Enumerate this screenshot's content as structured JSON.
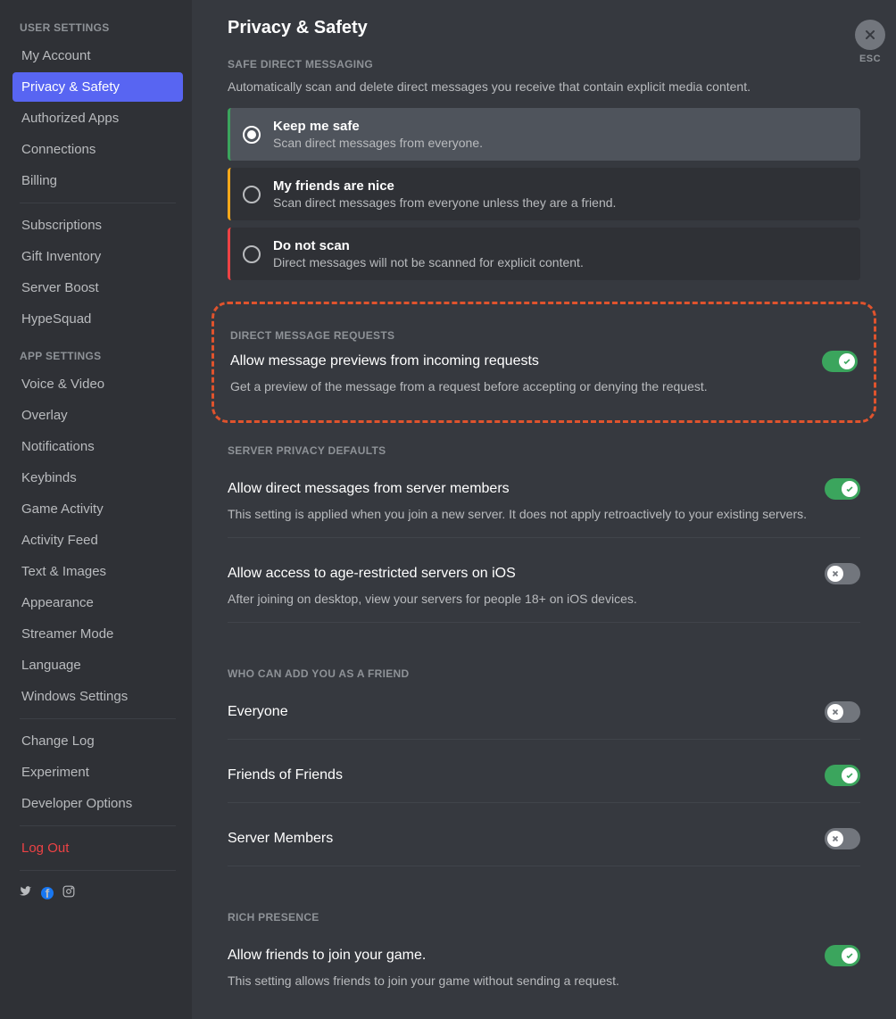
{
  "sidebar": {
    "heading_user": "USER SETTINGS",
    "heading_app": "APP SETTINGS",
    "items_user": [
      {
        "label": "My Account"
      },
      {
        "label": "Privacy & Safety"
      },
      {
        "label": "Authorized Apps"
      },
      {
        "label": "Connections"
      },
      {
        "label": "Billing"
      }
    ],
    "items_user2": [
      {
        "label": "Subscriptions"
      },
      {
        "label": "Gift Inventory"
      },
      {
        "label": "Server Boost"
      },
      {
        "label": "HypeSquad"
      }
    ],
    "items_app": [
      {
        "label": "Voice & Video"
      },
      {
        "label": "Overlay"
      },
      {
        "label": "Notifications"
      },
      {
        "label": "Keybinds"
      },
      {
        "label": "Game Activity"
      },
      {
        "label": "Activity Feed"
      },
      {
        "label": "Text & Images"
      },
      {
        "label": "Appearance"
      },
      {
        "label": "Streamer Mode"
      },
      {
        "label": "Language"
      },
      {
        "label": "Windows Settings"
      }
    ],
    "items_misc": [
      {
        "label": "Change Log"
      },
      {
        "label": "Experiment"
      },
      {
        "label": "Developer Options"
      }
    ],
    "logout": "Log Out"
  },
  "esc_label": "ESC",
  "page_title": "Privacy & Safety",
  "safe_dm": {
    "heading": "SAFE DIRECT MESSAGING",
    "desc": "Automatically scan and delete direct messages you receive that contain explicit media content.",
    "options": [
      {
        "title": "Keep me safe",
        "sub": "Scan direct messages from everyone."
      },
      {
        "title": "My friends are nice",
        "sub": "Scan direct messages from everyone unless they are a friend."
      },
      {
        "title": "Do not scan",
        "sub": "Direct messages will not be scanned for explicit content."
      }
    ]
  },
  "dm_requests": {
    "heading": "DIRECT MESSAGE REQUESTS",
    "title": "Allow message previews from incoming requests",
    "sub": "Get a preview of the message from a request before accepting or denying the request."
  },
  "server_privacy": {
    "heading": "SERVER PRIVACY DEFAULTS",
    "row1_title": "Allow direct messages from server members",
    "row1_sub": "This setting is applied when you join a new server. It does not apply retroactively to your existing servers.",
    "row2_title": "Allow access to age-restricted servers on iOS",
    "row2_sub": "After joining on desktop, view your servers for people 18+ on iOS devices."
  },
  "friends": {
    "heading": "WHO CAN ADD YOU AS A FRIEND",
    "row1": "Everyone",
    "row2": "Friends of Friends",
    "row3": "Server Members"
  },
  "rich": {
    "heading": "RICH PRESENCE",
    "title": "Allow friends to join your game.",
    "sub": "This setting allows friends to join your game without sending a request."
  }
}
